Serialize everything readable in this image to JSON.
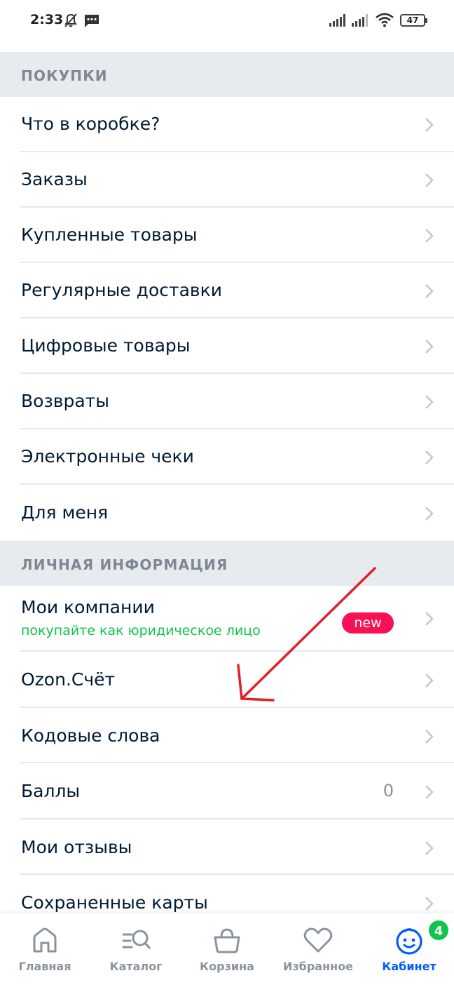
{
  "status_bar": {
    "time": "2:33",
    "battery": "47"
  },
  "sections": {
    "purchases": {
      "title": "ПОКУПКИ",
      "items": [
        {
          "label": "Что в коробке?"
        },
        {
          "label": "Заказы"
        },
        {
          "label": "Купленные товары"
        },
        {
          "label": "Регулярные доставки"
        },
        {
          "label": "Цифровые товары"
        },
        {
          "label": "Возвраты"
        },
        {
          "label": "Электронные чеки"
        },
        {
          "label": "Для меня"
        }
      ]
    },
    "personal": {
      "title": "ЛИЧНАЯ ИНФОРМАЦИЯ",
      "items": [
        {
          "label": "Мои компании",
          "sublabel": "покупайте как юридическое лицо",
          "badge": "new"
        },
        {
          "label": "Ozon.Счёт"
        },
        {
          "label": "Кодовые слова"
        },
        {
          "label": "Баллы",
          "value": "0"
        },
        {
          "label": "Мои отзывы"
        },
        {
          "label": "Сохраненные карты"
        }
      ]
    }
  },
  "bottom_nav": {
    "items": [
      {
        "label": "Главная",
        "icon": "home-icon"
      },
      {
        "label": "Каталог",
        "icon": "catalog-search-icon"
      },
      {
        "label": "Корзина",
        "icon": "cart-icon"
      },
      {
        "label": "Избранное",
        "icon": "heart-icon"
      },
      {
        "label": "Кабинет",
        "icon": "profile-face-icon"
      }
    ],
    "active_index": 4,
    "cabinet_badge": "4"
  },
  "colors": {
    "accent_blue": "#005bff",
    "new_badge": "#f91155",
    "green": "#10c44c",
    "annotation_arrow": "#e3202a"
  }
}
